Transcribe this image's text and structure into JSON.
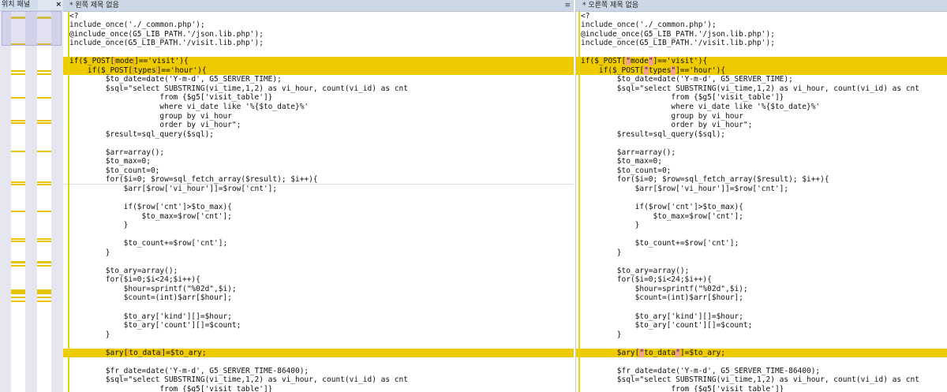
{
  "location_panel": {
    "title": "위치 패널",
    "close": "×"
  },
  "left": {
    "title": "* 왼쪽 제목 없음",
    "menu": "≡",
    "lines": [
      {
        "s": [
          "<?"
        ]
      },
      {
        "s": [
          "include_once('./_common.php');"
        ]
      },
      {
        "s": [
          "@include_once(G5_LIB_PATH.'/json.lib.php');"
        ]
      },
      {
        "s": [
          "include_once(G5_LIB_PATH.'/visit.lib.php');"
        ]
      },
      {
        "s": [
          ""
        ]
      },
      {
        "hl": true,
        "s": [
          "if($_POST[",
          {
            "m": 1
          },
          "mode",
          {
            "m": 1
          },
          "]=='visit'){"
        ]
      },
      {
        "hl": true,
        "s": [
          "    if($_POST[",
          {
            "m": 1
          },
          "types",
          {
            "m": 1
          },
          "]=='hour'){"
        ]
      },
      {
        "s": [
          "        $to_date=date('Y-m-d', G5_SERVER_TIME);"
        ]
      },
      {
        "s": [
          "        $sql=\"select SUBSTRING(vi_time,1,2) as vi_hour, count(vi_id) as cnt"
        ]
      },
      {
        "s": [
          "                    from {$g5['visit_table']}"
        ]
      },
      {
        "s": [
          "                    where vi_date like '%{$to_date}%'"
        ]
      },
      {
        "s": [
          "                    group by vi_hour"
        ]
      },
      {
        "s": [
          "                    order by vi_hour\";"
        ]
      },
      {
        "s": [
          "        $result=sql_query($sql);"
        ]
      },
      {
        "s": [
          ""
        ]
      },
      {
        "s": [
          "        $arr=array();"
        ]
      },
      {
        "s": [
          "        $to_max=0;"
        ]
      },
      {
        "s": [
          "        $to_count=0;"
        ]
      },
      {
        "cur": true,
        "s": [
          "        for($i=0; $row=sql_fetch_array($result); $i++){"
        ]
      },
      {
        "s": [
          "            $arr[$row['vi_hour']]=$row['cnt'];"
        ]
      },
      {
        "s": [
          ""
        ]
      },
      {
        "s": [
          "            if($row['cnt']>$to_max){"
        ]
      },
      {
        "s": [
          "                $to_max=$row['cnt'];"
        ]
      },
      {
        "s": [
          "            }"
        ]
      },
      {
        "s": [
          ""
        ]
      },
      {
        "s": [
          "            $to_count+=$row['cnt'];"
        ]
      },
      {
        "s": [
          "        }"
        ]
      },
      {
        "s": [
          ""
        ]
      },
      {
        "s": [
          "        $to_ary=array();"
        ]
      },
      {
        "s": [
          "        for($i=0;$i<24;$i++){"
        ]
      },
      {
        "s": [
          "            $hour=sprintf(\"%02d\",$i);"
        ]
      },
      {
        "s": [
          "            $count=(int)$arr[$hour];"
        ]
      },
      {
        "s": [
          ""
        ]
      },
      {
        "s": [
          "            $to_ary['kind'][]=$hour;"
        ]
      },
      {
        "s": [
          "            $to_ary['count'][]=$count;"
        ]
      },
      {
        "s": [
          "        }"
        ]
      },
      {
        "s": [
          ""
        ]
      },
      {
        "hl": true,
        "s": [
          "        $ary[",
          {
            "m": 1
          },
          "to_data",
          {
            "m": 1
          },
          "]=$to_ary;"
        ]
      },
      {
        "s": [
          ""
        ]
      },
      {
        "s": [
          "        $fr_date=date('Y-m-d', G5_SERVER_TIME-86400);"
        ]
      },
      {
        "s": [
          "        $sql=\"select SUBSTRING(vi_time,1,2) as vi_hour, count(vi_id) as cnt"
        ]
      },
      {
        "s": [
          "                    from {$g5['visit_table']}"
        ]
      }
    ]
  },
  "right": {
    "title": "* 오른쪽 제목 없음",
    "lines": [
      {
        "s": [
          "<?"
        ]
      },
      {
        "s": [
          "include_once('./_common.php');"
        ]
      },
      {
        "s": [
          "@include_once(G5_LIB_PATH.'/json.lib.php');"
        ]
      },
      {
        "s": [
          "include_once(G5_LIB_PATH.'/visit.lib.php');"
        ]
      },
      {
        "s": [
          ""
        ]
      },
      {
        "hl": true,
        "s": [
          "if($_POST[",
          {
            "t": "\"",
            "d": 1
          },
          "mode",
          {
            "t": "\"",
            "d": 1
          },
          "]=='visit'){"
        ]
      },
      {
        "hl": true,
        "s": [
          "    if($_POST[",
          {
            "t": "\"",
            "d": 1
          },
          "types",
          {
            "t": "\"",
            "d": 1
          },
          "]=='hour'){"
        ]
      },
      {
        "s": [
          "        $to_date=date('Y-m-d', G5_SERVER_TIME);"
        ]
      },
      {
        "s": [
          "        $sql=\"select SUBSTRING(vi_time,1,2) as vi_hour, count(vi_id) as cnt"
        ]
      },
      {
        "s": [
          "                    from {$g5['visit_table']}"
        ]
      },
      {
        "s": [
          "                    where vi_date like '%{$to_date}%'"
        ]
      },
      {
        "s": [
          "                    group by vi_hour"
        ]
      },
      {
        "s": [
          "                    order by vi_hour\";"
        ]
      },
      {
        "s": [
          "        $result=sql_query($sql);"
        ]
      },
      {
        "s": [
          ""
        ]
      },
      {
        "s": [
          "        $arr=array();"
        ]
      },
      {
        "s": [
          "        $to_max=0;"
        ]
      },
      {
        "s": [
          "        $to_count=0;"
        ]
      },
      {
        "s": [
          "        for($i=0; $row=sql_fetch_array($result); $i++){"
        ]
      },
      {
        "s": [
          "            $arr[$row['vi_hour']]=$row['cnt'];"
        ]
      },
      {
        "s": [
          ""
        ]
      },
      {
        "s": [
          "            if($row['cnt']>$to_max){"
        ]
      },
      {
        "s": [
          "                $to_max=$row['cnt'];"
        ]
      },
      {
        "s": [
          "            }"
        ]
      },
      {
        "s": [
          ""
        ]
      },
      {
        "s": [
          "            $to_count+=$row['cnt'];"
        ]
      },
      {
        "s": [
          "        }"
        ]
      },
      {
        "s": [
          ""
        ]
      },
      {
        "s": [
          "        $to_ary=array();"
        ]
      },
      {
        "s": [
          "        for($i=0;$i<24;$i++){"
        ]
      },
      {
        "s": [
          "            $hour=sprintf(\"%02d\",$i);"
        ]
      },
      {
        "s": [
          "            $count=(int)$arr[$hour];"
        ]
      },
      {
        "s": [
          ""
        ]
      },
      {
        "s": [
          "            $to_ary['kind'][]=$hour;"
        ]
      },
      {
        "s": [
          "            $to_ary['count'][]=$count;"
        ]
      },
      {
        "s": [
          "        }"
        ]
      },
      {
        "s": [
          ""
        ]
      },
      {
        "hl": true,
        "s": [
          "        $ary[",
          {
            "t": "\"",
            "d": 1
          },
          "to_data",
          {
            "t": "\"",
            "d": 1
          },
          "]=$to_ary;"
        ]
      },
      {
        "s": [
          ""
        ]
      },
      {
        "s": [
          "        $fr_date=date('Y-m-d', G5_SERVER_TIME-86400);"
        ]
      },
      {
        "s": [
          "        $sql=\"select SUBSTRING(vi_time,1,2) as vi_hour, count(vi_id) as cnt"
        ]
      },
      {
        "s": [
          "                    from {$g5['visit_table']}"
        ]
      }
    ]
  }
}
